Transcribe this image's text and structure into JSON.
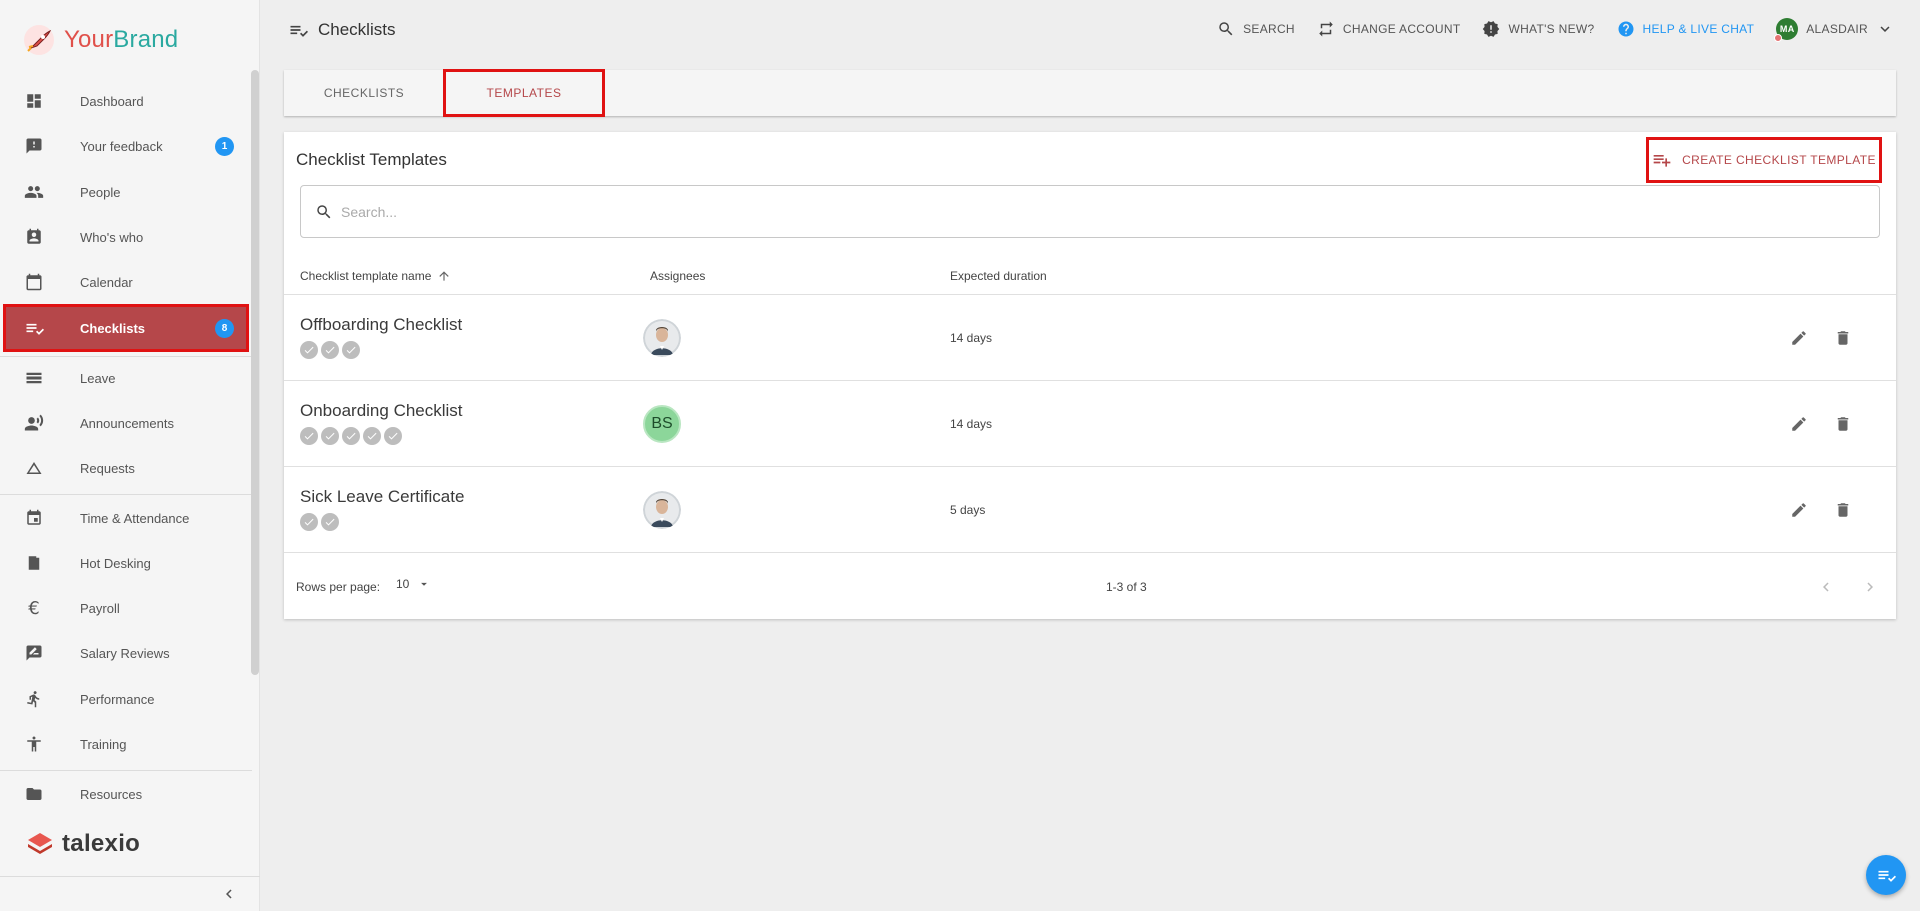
{
  "brand": {
    "your": "Your",
    "rest": "Brand",
    "footer_logo": "talexio"
  },
  "sidebar": {
    "items": [
      {
        "label": "Dashboard",
        "icon": "dashboard-icon"
      },
      {
        "label": "Your feedback",
        "icon": "feedback-icon",
        "badge": "1"
      },
      {
        "label": "People",
        "icon": "people-icon"
      },
      {
        "label": "Who's who",
        "icon": "contact-card-icon"
      },
      {
        "label": "Calendar",
        "icon": "calendar-icon"
      },
      {
        "label": "Checklists",
        "icon": "checklist-icon",
        "badge": "8",
        "active": true
      },
      {
        "label": "Leave",
        "icon": "leave-icon"
      },
      {
        "label": "Announcements",
        "icon": "megaphone-icon"
      },
      {
        "label": "Requests",
        "icon": "triangle-icon"
      },
      {
        "label": "Time & Attendance",
        "icon": "event-icon"
      },
      {
        "label": "Hot Desking",
        "icon": "door-icon"
      },
      {
        "label": "Payroll",
        "icon": "euro-icon"
      },
      {
        "label": "Salary Reviews",
        "icon": "rate-review-icon"
      },
      {
        "label": "Performance",
        "icon": "run-icon"
      },
      {
        "label": "Training",
        "icon": "accessibility-icon"
      },
      {
        "label": "Resources",
        "icon": "folder-icon"
      }
    ]
  },
  "header": {
    "title": "Checklists",
    "actions": {
      "search": "SEARCH",
      "change_account": "CHANGE ACCOUNT",
      "whats_new": "WHAT'S NEW?",
      "help": "HELP & LIVE CHAT",
      "user_initials": "MA",
      "user_name": "ALASDAIR"
    }
  },
  "tabs": [
    {
      "label": "CHECKLISTS"
    },
    {
      "label": "TEMPLATES",
      "active": true
    }
  ],
  "card": {
    "title": "Checklist Templates",
    "create_label": "CREATE CHECKLIST TEMPLATE",
    "search_placeholder": "Search...",
    "columns": {
      "name": "Checklist template name",
      "assignees": "Assignees",
      "duration": "Expected duration"
    },
    "rows": [
      {
        "name": "Offboarding Checklist",
        "steps": 3,
        "assignee": "photo",
        "duration": "14 days"
      },
      {
        "name": "Onboarding Checklist",
        "steps": 5,
        "assignee": "BS",
        "duration": "14 days"
      },
      {
        "name": "Sick Leave Certificate",
        "steps": 2,
        "assignee": "photo",
        "duration": "5 days"
      }
    ],
    "footer": {
      "rows_per_page_label": "Rows per page:",
      "rows_per_page": "10",
      "range": "1-3 of 3"
    }
  },
  "colors": {
    "accent": "#b5474a",
    "highlight": "#e01212",
    "badge": "#2196f3",
    "help": "#2196f3"
  }
}
